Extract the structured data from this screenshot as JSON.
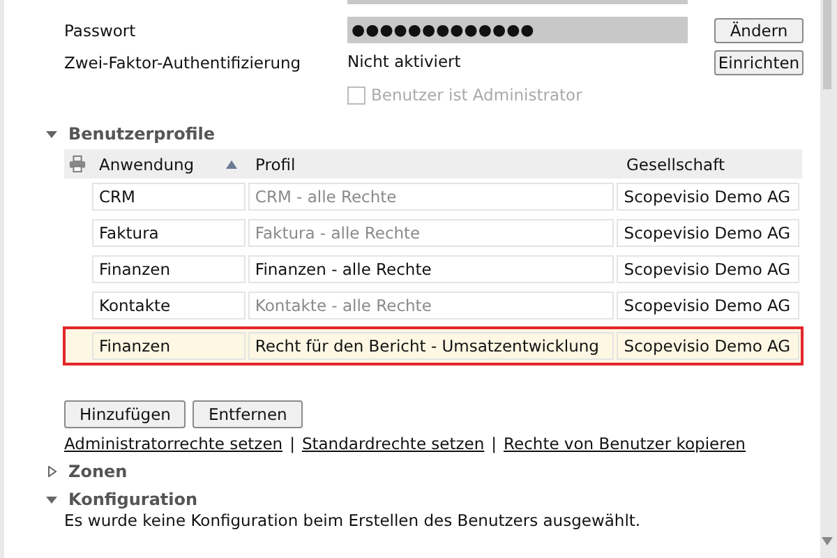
{
  "form": {
    "rows": [
      {
        "kind": "password",
        "label": "Passwort",
        "value": "●●●●●●●●●●●●●",
        "button": "Ändern"
      },
      {
        "kind": "text",
        "label": "Zwei-Faktor-Authentifizierung",
        "value": "Nicht aktiviert",
        "button": "Einrichten"
      }
    ],
    "admin_checkbox": {
      "label": "Benutzer ist Administrator",
      "checked": false,
      "disabled": true
    }
  },
  "profiles": {
    "title": "Benutzerprofile",
    "expanded": true,
    "columns": [
      {
        "label": "Anwendung",
        "sorted": true
      },
      {
        "label": "Profil",
        "sorted": false
      },
      {
        "label": "Gesellschaft",
        "sorted": false
      }
    ],
    "rows": [
      {
        "application": "CRM",
        "profile": "CRM - alle Rechte",
        "company": "Scopevisio Demo AG",
        "dimmed": true,
        "selected": false
      },
      {
        "application": "Faktura",
        "profile": "Faktura - alle Rechte",
        "company": "Scopevisio Demo AG",
        "dimmed": true,
        "selected": false
      },
      {
        "application": "Finanzen",
        "profile": "Finanzen - alle Rechte",
        "company": "Scopevisio Demo AG",
        "dimmed": false,
        "selected": false
      },
      {
        "application": "Kontakte",
        "profile": "Kontakte - alle Rechte",
        "company": "Scopevisio Demo AG",
        "dimmed": true,
        "selected": false
      },
      {
        "application": "Finanzen",
        "profile": "Recht für den Bericht - Umsatzentwicklung",
        "company": "Scopevisio Demo AG",
        "dimmed": false,
        "selected": true
      }
    ],
    "buttons": [
      "Hinzufügen",
      "Entfernen"
    ],
    "links": [
      "Administratorrechte setzen",
      "Standardrechte setzen",
      "Rechte von Benutzer kopieren"
    ],
    "link_separator": "|"
  },
  "sections": [
    {
      "title": "Zonen",
      "expanded": false
    },
    {
      "title": "Konfiguration",
      "expanded": true,
      "text": "Es wurde keine Konfiguration beim Erstellen des Benutzers ausgewählt."
    }
  ]
}
